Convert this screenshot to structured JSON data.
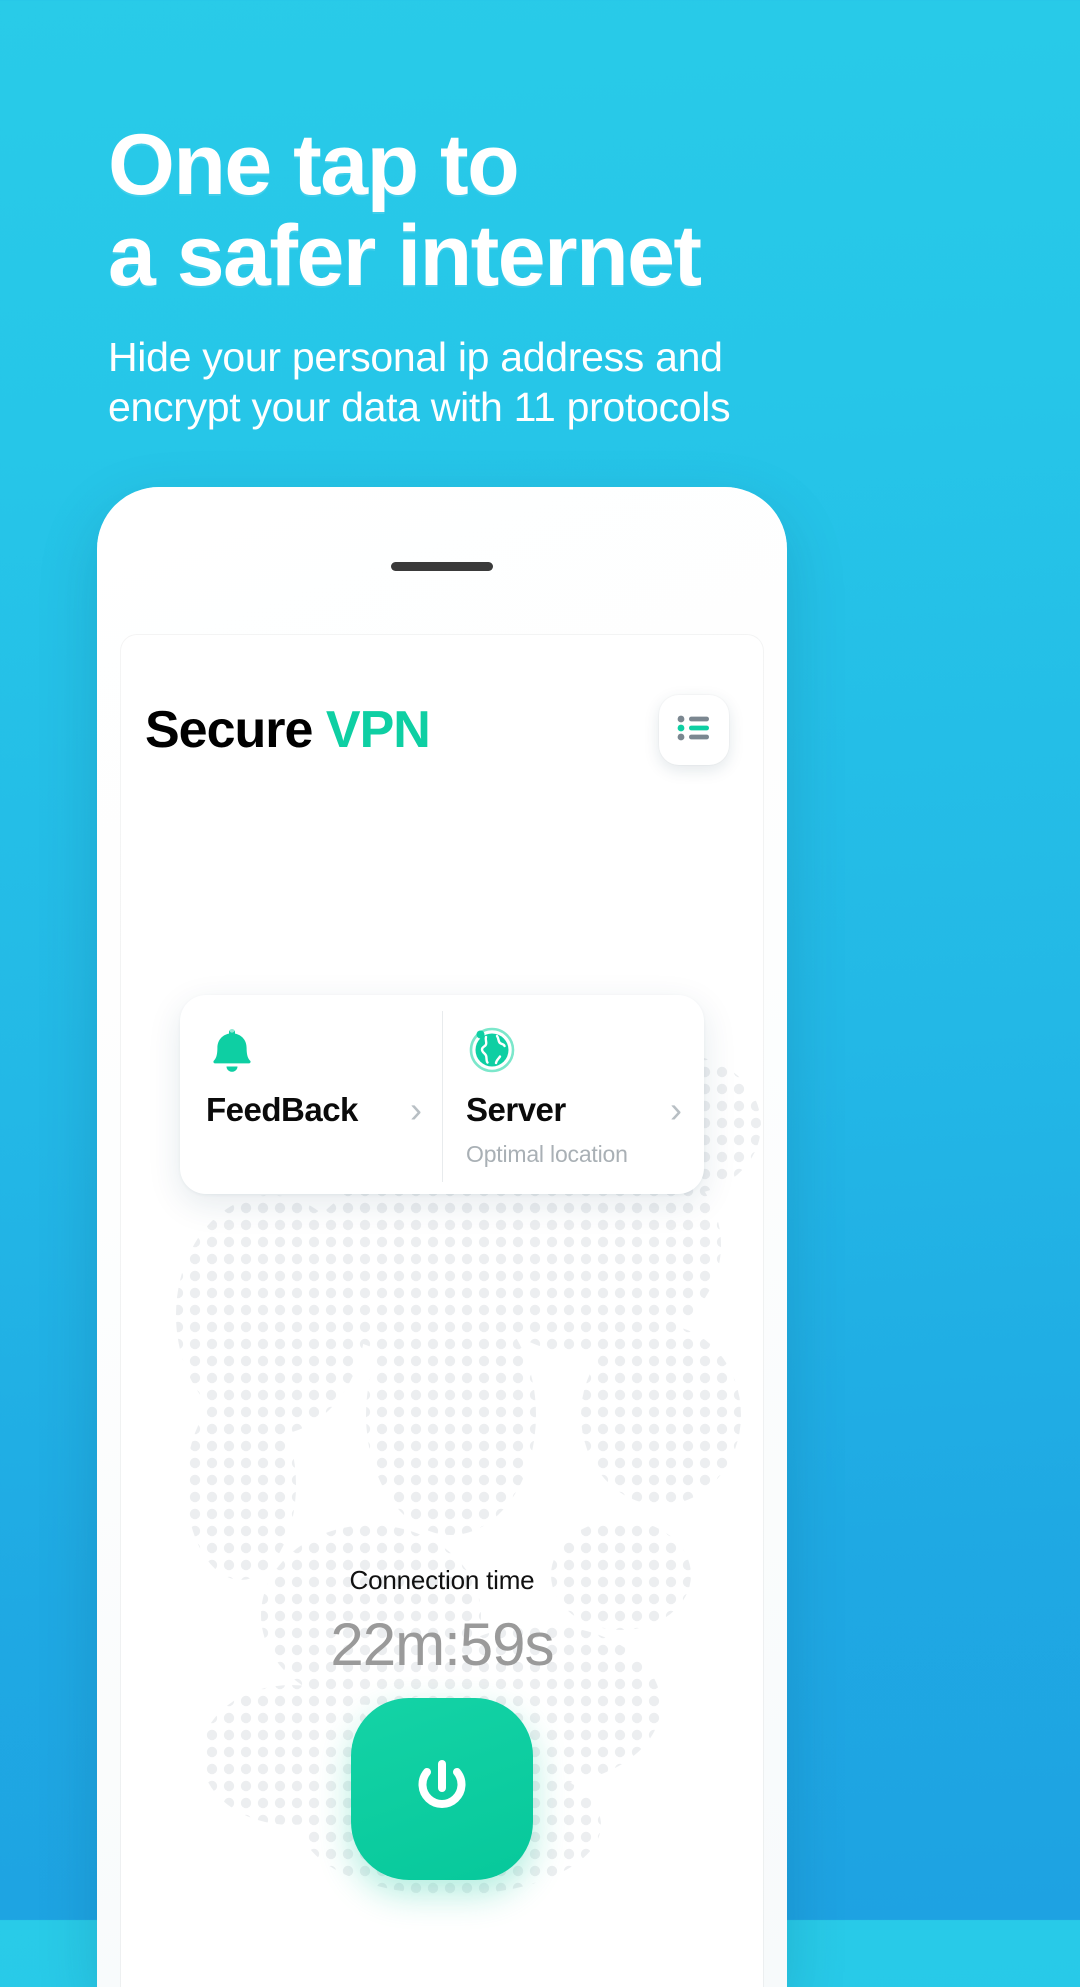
{
  "promo": {
    "title": "One tap to\na safer internet",
    "subtitle": "Hide your personal ip address and\nencrypt your data with 11 protocols",
    "title_color": "#ffffff",
    "background_color": "#23bfe7"
  },
  "app": {
    "title_primary": "Secure",
    "title_accent": "VPN",
    "accent_color": "#0ECFA3",
    "list_button_icon": "list-icon"
  },
  "quick_card": {
    "feedback": {
      "icon": "bell-icon",
      "label": "FeedBack",
      "chevron": "›"
    },
    "server": {
      "icon": "globe-icon",
      "label": "Server",
      "subtitle": "Optimal location",
      "chevron": "›"
    }
  },
  "connection": {
    "label": "Connection time",
    "value": "22m:59s",
    "value_color": "#9a9a9a"
  },
  "power_button": {
    "icon": "power-icon",
    "color": "#0FCEA0"
  }
}
